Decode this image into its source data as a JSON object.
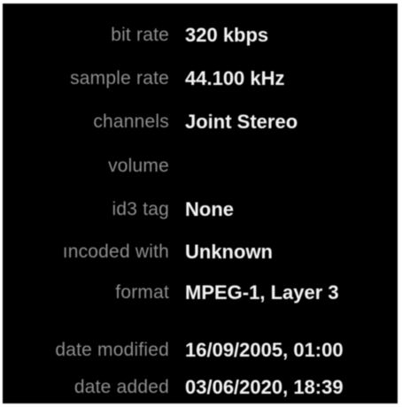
{
  "info_panel": {
    "rows": [
      {
        "label": "bit rate",
        "value": "320 kbps"
      },
      {
        "label": "sample rate",
        "value": "44.100 kHz"
      },
      {
        "label": "channels",
        "value": "Joint Stereo"
      },
      {
        "label": "volume",
        "value": ""
      },
      {
        "label": "id3 tag",
        "value": "None"
      },
      {
        "label": "ıncoded with",
        "value": "Unknown"
      },
      {
        "label": "format",
        "value": "MPEG-1, Layer 3"
      },
      {
        "label": "date modified",
        "value": "16/09/2005, 01:00"
      },
      {
        "label": "date added",
        "value": "03/06/2020, 18:39"
      }
    ]
  },
  "colors": {
    "background": "#000000",
    "label_text": "#8e8e8e",
    "value_text": "#f2f2f2",
    "border": "#ffffff"
  }
}
